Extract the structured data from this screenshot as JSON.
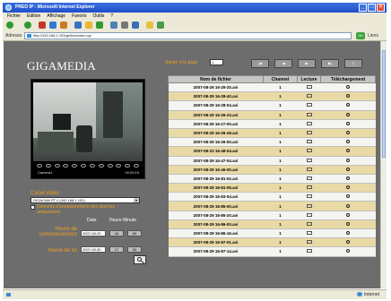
{
  "window": {
    "title": "PREO IP - Microsoft Internet Explorer"
  },
  "menu": [
    "Fichier",
    "Edition",
    "Affichage",
    "Favoris",
    "Outils",
    "?"
  ],
  "address": {
    "label": "Adresse",
    "url": "http://192.168.1.153/gr/itek/index.cgi",
    "go": "OK",
    "links": "Liens"
  },
  "status": {
    "zone": "Internet"
  },
  "logo": {
    "text": "GIGAMEDIA"
  },
  "player": {
    "camera_label": "Camera1",
    "time": "00:00:15"
  },
  "search": {
    "canal_label": "Canal vidéo",
    "canal_value": "GIGACAM PT 0 (192.168.1.151)",
    "checkbox_label": "Données d'enregistrement des alarmes uniquement",
    "date_header": "Date",
    "time_header": "Heure Minute",
    "start_label": "Heure de commencement",
    "end_label": "Heure de fin",
    "start_date": "2007-08-29",
    "start_hour": "16",
    "start_min": "00",
    "end_date": "2007-08-30",
    "end_hour": "17",
    "end_min": "00"
  },
  "paging": {
    "label": "Sauter à la page",
    "page": "1"
  },
  "table": {
    "headers": [
      "Nom de fichier",
      "Channel",
      "Lecture",
      "Téléchargement"
    ],
    "rows": [
      [
        "2007-08-29 16-29-20.avi",
        "1"
      ],
      [
        "2007-08-29 16-28-40.avi",
        "1"
      ],
      [
        "2007-08-29 16-28-04.avi",
        "1"
      ],
      [
        "2007-08-29 16-26-23.avi",
        "1"
      ],
      [
        "2007-08-29 16-27-00.avi",
        "1"
      ],
      [
        "2007-08-29 16-26-28.avi",
        "1"
      ],
      [
        "2007-08-29 16-26-00.avi",
        "1"
      ],
      [
        "2007-08-23 16-48-04.avi",
        "1"
      ],
      [
        "2007-08-29 16-47-04.avi",
        "1"
      ],
      [
        "2007-08-29 16-46-00.avi",
        "1"
      ],
      [
        "2007-08-29 16-81-02.avi",
        "1"
      ],
      [
        "2007-08-29 16-81-05.avi",
        "1"
      ],
      [
        "2007-08-29 16-83-04.avi",
        "1"
      ],
      [
        "2007-08-29 16-85-00.avi",
        "1"
      ],
      [
        "2007-08-29 16-85-20.avi",
        "1"
      ],
      [
        "2007-08-29 16-86-00.avi",
        "1"
      ],
      [
        "2007-08-29 16-86-16.avi",
        "1"
      ],
      [
        "2007-08-29 16-87-01.avi",
        "1"
      ],
      [
        "2007-08-29 16-87-14.avi",
        "1"
      ]
    ]
  }
}
